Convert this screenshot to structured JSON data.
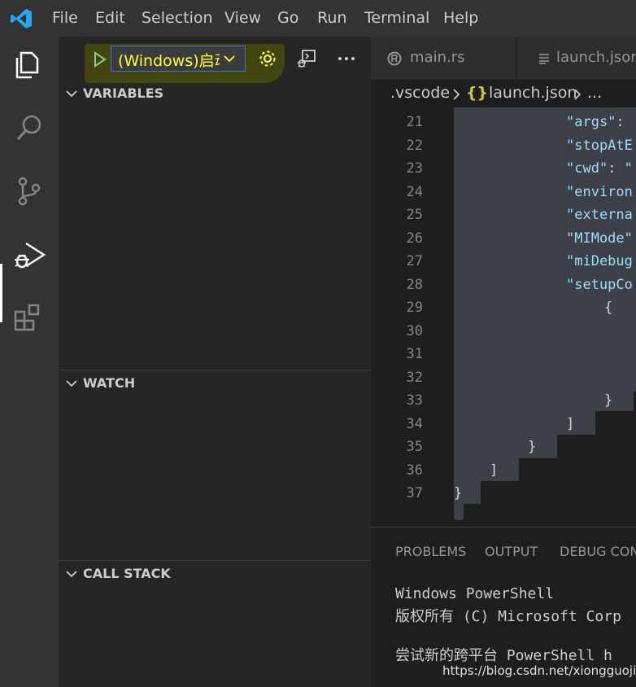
{
  "menu": {
    "items": [
      "File",
      "Edit",
      "Selection",
      "View",
      "Go",
      "Run",
      "Terminal",
      "Help"
    ]
  },
  "activity_bar": {
    "icons": [
      "explorer-icon",
      "search-icon",
      "source-control-icon",
      "run-debug-icon",
      "extensions-icon"
    ],
    "active": "run-debug-icon"
  },
  "debug": {
    "config_label": "(Windows)启动",
    "accent": "#ffff3a"
  },
  "sidebar": {
    "sections": [
      "VARIABLES",
      "WATCH",
      "CALL STACK"
    ]
  },
  "editor": {
    "tabs": [
      "main.rs",
      "launch.json"
    ],
    "breadcrumb": [
      ".vscode",
      "{}",
      "launch.json",
      "..."
    ],
    "lines": [
      {
        "n": "21",
        "text": "\"args\":"
      },
      {
        "n": "22",
        "text": "\"stopAtE"
      },
      {
        "n": "23",
        "text": "\"cwd\": \""
      },
      {
        "n": "24",
        "text": "\"environ"
      },
      {
        "n": "25",
        "text": "\"externa"
      },
      {
        "n": "26",
        "text": "\"MIMode\""
      },
      {
        "n": "27",
        "text": "\"miDebug"
      },
      {
        "n": "28",
        "text": "\"setupCo"
      },
      {
        "n": "29",
        "text": "{"
      },
      {
        "n": "30",
        "text": ""
      },
      {
        "n": "31",
        "text": ""
      },
      {
        "n": "32",
        "text": ""
      },
      {
        "n": "33",
        "text": "}"
      },
      {
        "n": "34",
        "text": "]"
      },
      {
        "n": "35",
        "text": "}"
      },
      {
        "n": "36",
        "text": "]"
      },
      {
        "n": "37",
        "text": "}"
      }
    ]
  },
  "panel": {
    "tabs": [
      "PROBLEMS",
      "OUTPUT",
      "DEBUG CONS"
    ],
    "terminal_lines": [
      "Windows PowerShell",
      "版权所有 (C) Microsoft Corp",
      "",
      "尝试新的跨平台 PowerShell h"
    ]
  },
  "watermark": "https://blog.csdn.net/xiongguojie"
}
